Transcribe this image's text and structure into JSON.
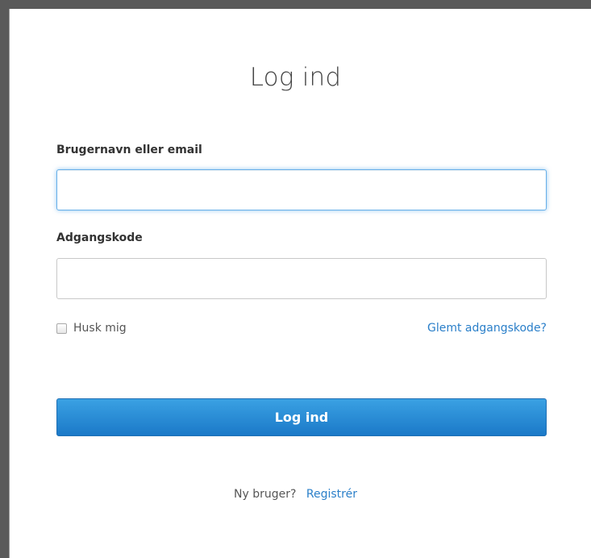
{
  "login": {
    "title": "Log ind",
    "username_label": "Brugernavn eller email",
    "username_value": "",
    "password_label": "Adgangskode",
    "password_value": "",
    "remember_label": "Husk mig",
    "forgot_label": "Glemt adgangskode?",
    "submit_label": "Log ind",
    "new_user_text": "Ny bruger?",
    "register_label": "Registrér"
  },
  "colors": {
    "accent": "#1b79c8",
    "link": "#2a7fc9",
    "focus": "#66afe9"
  }
}
